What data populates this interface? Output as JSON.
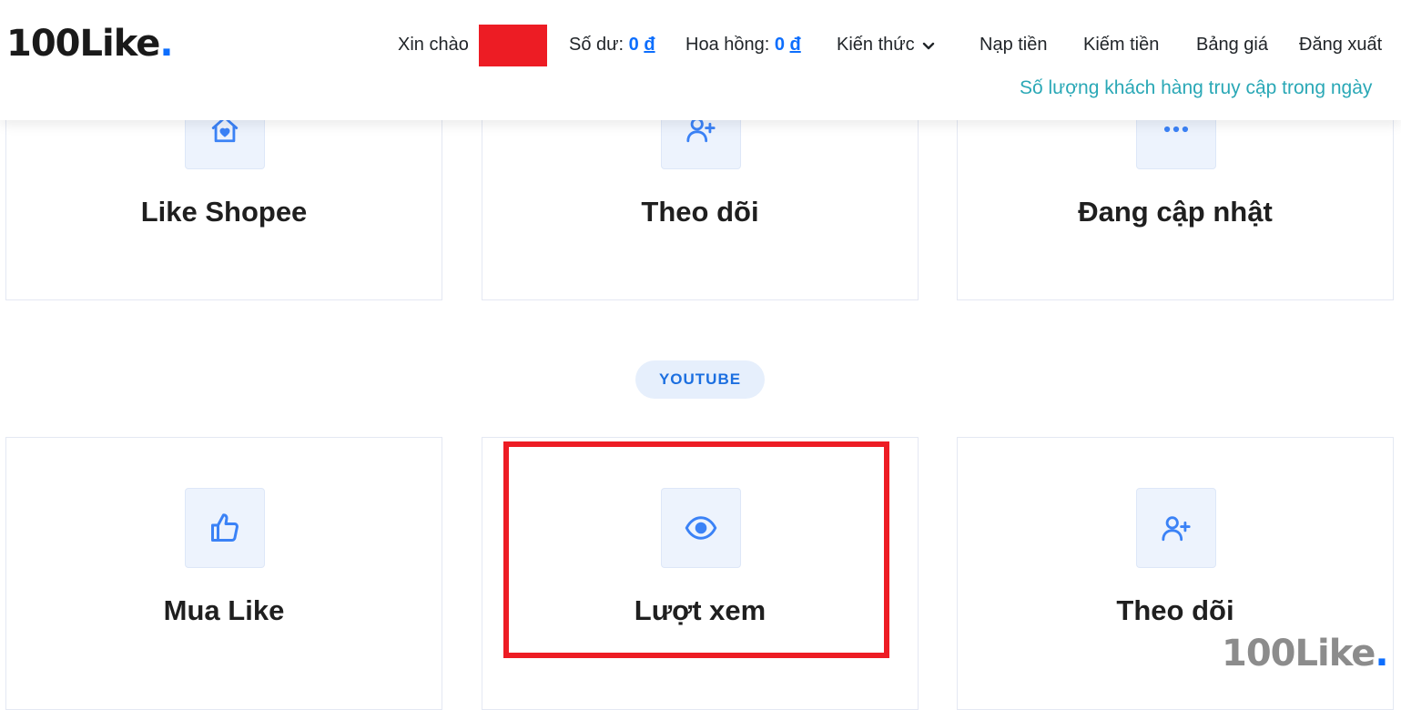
{
  "header": {
    "logo_text": "100Like",
    "logo_dot": ".",
    "greeting": "Xin chào",
    "balance_label": "Số dư:",
    "balance_value": "0",
    "currency": "đ",
    "commission_label": "Hoa hồng:",
    "commission_value": "0",
    "nav": {
      "knowledge": "Kiến thức",
      "deposit": "Nạp tiền",
      "earn": "Kiếm tiền",
      "pricing": "Bảng giá",
      "logout": "Đăng xuất"
    },
    "marquee": "Số lượng khách hàng truy cập trong ngày"
  },
  "top_cards": [
    {
      "title": "Like Shopee",
      "icon": "heart-home-icon"
    },
    {
      "title": "Theo dõi",
      "icon": "user-plus-icon"
    },
    {
      "title": "Đang cập nhật",
      "icon": "more-dots-icon"
    }
  ],
  "section": {
    "youtube_label": "YOUTUBE"
  },
  "youtube_cards": [
    {
      "title": "Mua Like",
      "icon": "thumbs-up-icon"
    },
    {
      "title": "Lượt xem",
      "icon": "eye-icon"
    },
    {
      "title": "Theo dõi",
      "icon": "user-plus-icon"
    }
  ],
  "watermark": {
    "text": "100Like",
    "dot": "."
  },
  "colors": {
    "accent": "#0d6efd",
    "icon": "#3b82f6",
    "marquee": "#2aa8b6",
    "highlight": "#ed1c24",
    "redaction": "#ed1c24"
  }
}
